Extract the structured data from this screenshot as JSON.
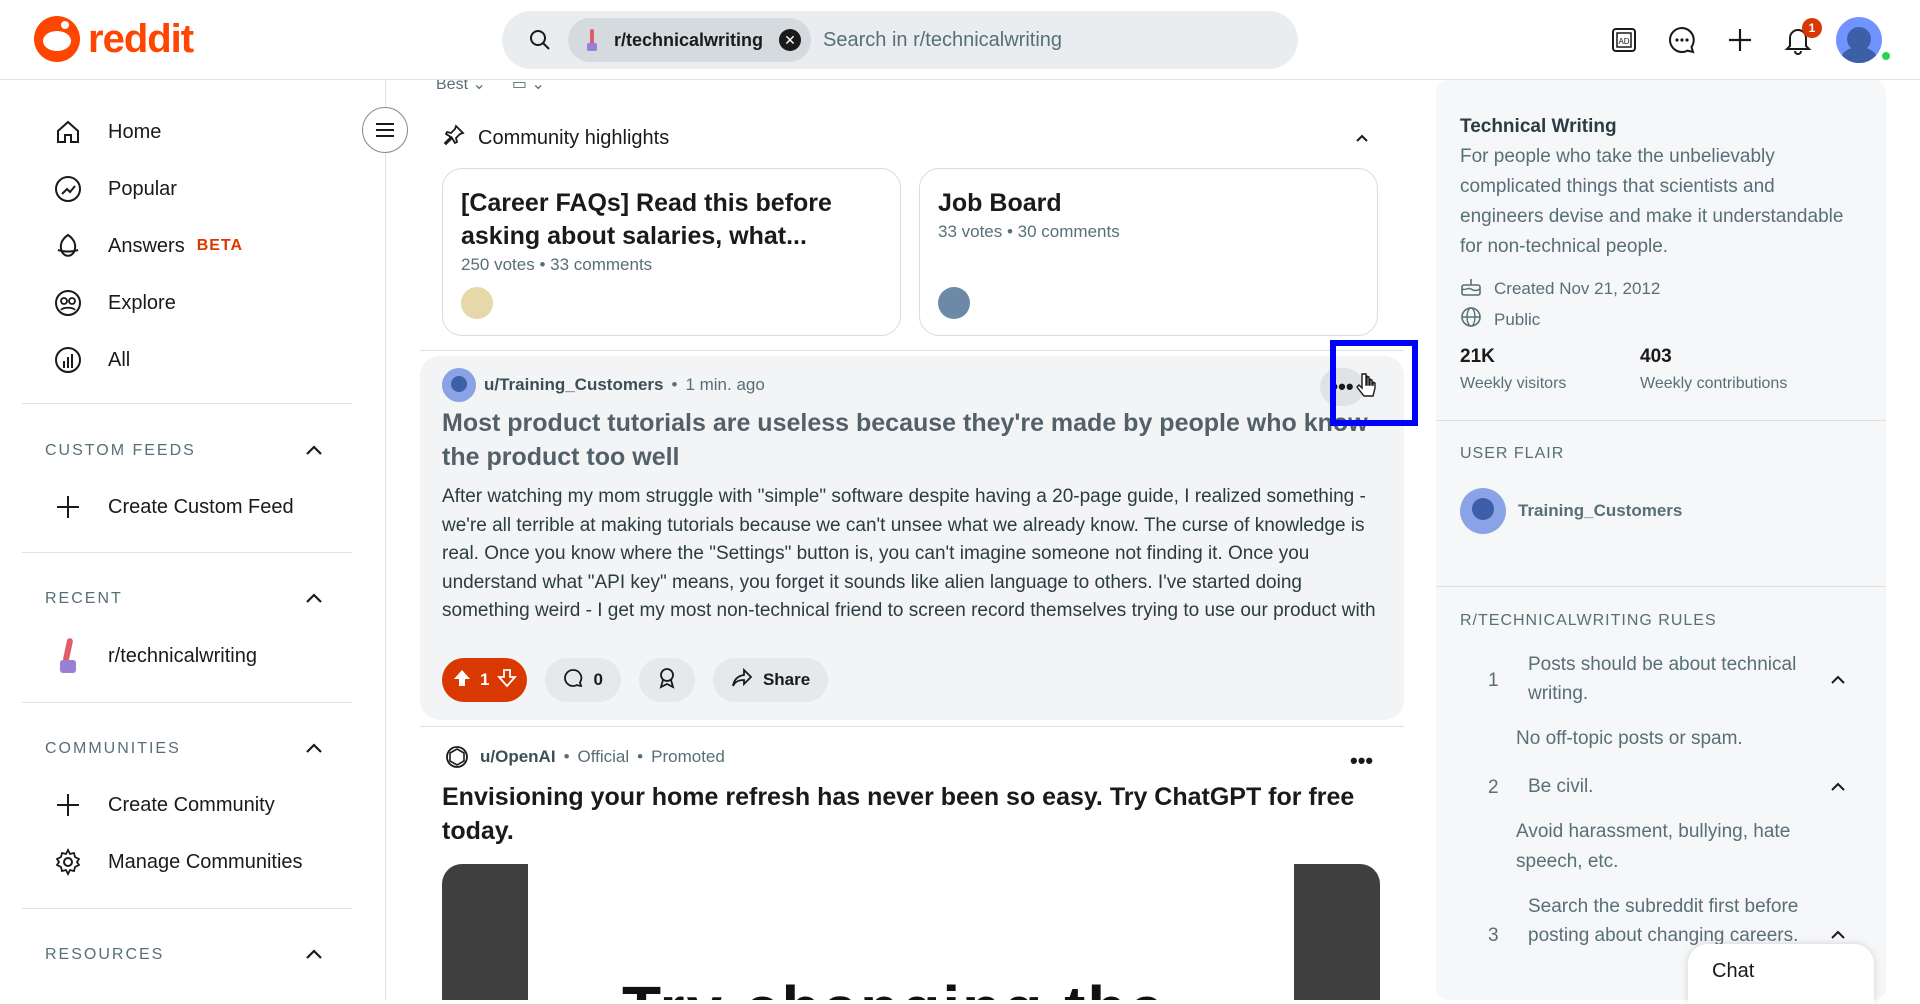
{
  "header": {
    "logo_text": "reddit",
    "search_chip": "r/technicalwriting",
    "search_placeholder": "Search in r/technicalwriting",
    "notification_count": "1"
  },
  "sidebar": {
    "nav": [
      {
        "label": "Home",
        "icon": "home-icon"
      },
      {
        "label": "Popular",
        "icon": "popular-icon"
      },
      {
        "label": "Answers",
        "icon": "answers-icon",
        "badge": "BETA"
      },
      {
        "label": "Explore",
        "icon": "explore-icon"
      },
      {
        "label": "All",
        "icon": "all-icon"
      }
    ],
    "custom_feeds": {
      "title": "CUSTOM FEEDS",
      "create": "Create Custom Feed"
    },
    "recent": {
      "title": "RECENT",
      "item": "r/technicalwriting"
    },
    "communities": {
      "title": "COMMUNITIES",
      "create": "Create Community",
      "manage": "Manage Communities"
    },
    "resources": {
      "title": "RESOURCES"
    }
  },
  "main": {
    "sort": "Best",
    "highlights": {
      "title": "Community highlights",
      "cards": [
        {
          "title": "[Career FAQs] Read this before asking about salaries, what...",
          "votes": "250 votes",
          "comments": "33 comments"
        },
        {
          "title": "Job Board",
          "votes": "33 votes",
          "comments": "30 comments"
        }
      ]
    },
    "post": {
      "user": "u/Training_Customers",
      "time": "1 min. ago",
      "title": "Most product tutorials are useless because they're made by people who know the product too well",
      "body": "After watching my mom struggle with \"simple\" software despite having a 20-page guide, I realized something - we're all terrible at making tutorials because we can't unsee what we already know. The curse of knowledge is real. Once you know where the \"Settings\" button is, you can't imagine someone not finding it. Once you understand what \"API key\" means, you forget it sounds like alien language to others. I've started doing something weird - I get my most non-technical friend to screen record themselves trying to use our product with zero guidance. Then I build guides based on where they g...",
      "votes": "1",
      "comments": "0",
      "share": "Share"
    },
    "promoted": {
      "user": "u/OpenAI",
      "official": "Official",
      "promoted": "Promoted",
      "title": "Envisioning your home refresh has never been so easy. Try ChatGPT for free today.",
      "media_text": "Try changing the"
    }
  },
  "right": {
    "title": "Technical Writing",
    "desc": "For people who take the unbelievably complicated things that scientists and engineers devise and make it understandable for non-technical people.",
    "created": "Created Nov 21, 2012",
    "visibility": "Public",
    "visitors_n": "21K",
    "visitors_l": "Weekly visitors",
    "contrib_n": "403",
    "contrib_l": "Weekly contributions",
    "flair_title": "USER FLAIR",
    "flair_name": "Training_Customers",
    "rules_title": "R/TECHNICALWRITING RULES",
    "rules": [
      {
        "num": "1",
        "title": "Posts should be about technical writing.",
        "desc": "No off-topic posts or spam."
      },
      {
        "num": "2",
        "title": "Be civil.",
        "desc": "Avoid harassment, bullying, hate speech, etc."
      },
      {
        "num": "3",
        "title": "Search the subreddit first before posting about changing careers.",
        "desc": ""
      }
    ]
  },
  "chat": {
    "label": "Chat"
  },
  "colors": {
    "brand": "#ff4500",
    "upvote": "#d93900",
    "highlight_box": "#0000ff"
  }
}
